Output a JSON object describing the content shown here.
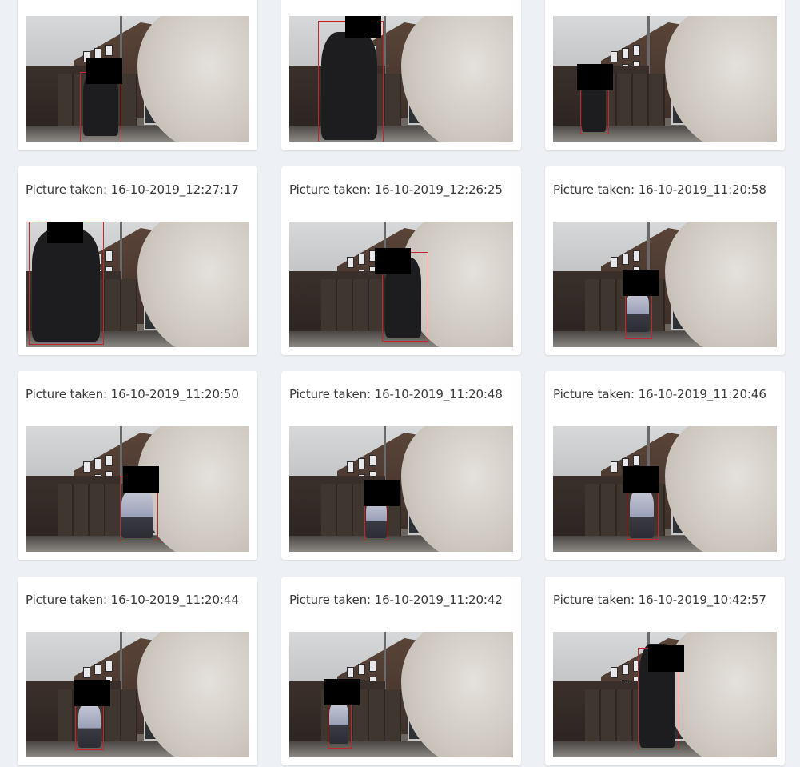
{
  "gallery": {
    "cards": [
      {
        "caption": ""
      },
      {
        "caption": ""
      },
      {
        "caption": ""
      },
      {
        "caption": "Picture taken: 16-10-2019_12:27:17"
      },
      {
        "caption": "Picture taken: 16-10-2019_12:26:25"
      },
      {
        "caption": "Picture taken: 16-10-2019_11:20:58"
      },
      {
        "caption": "Picture taken: 16-10-2019_11:20:50"
      },
      {
        "caption": "Picture taken: 16-10-2019_11:20:48"
      },
      {
        "caption": "Picture taken: 16-10-2019_11:20:46"
      },
      {
        "caption": "Picture taken: 16-10-2019_11:20:44"
      },
      {
        "caption": "Picture taken: 16-10-2019_11:20:42"
      },
      {
        "caption": "Picture taken: 16-10-2019_10:42:57"
      }
    ]
  },
  "colors": {
    "page_background": "#edf0f5",
    "card_background": "#ffffff",
    "bounding_box": "#c0262b",
    "redaction": "#000000"
  }
}
